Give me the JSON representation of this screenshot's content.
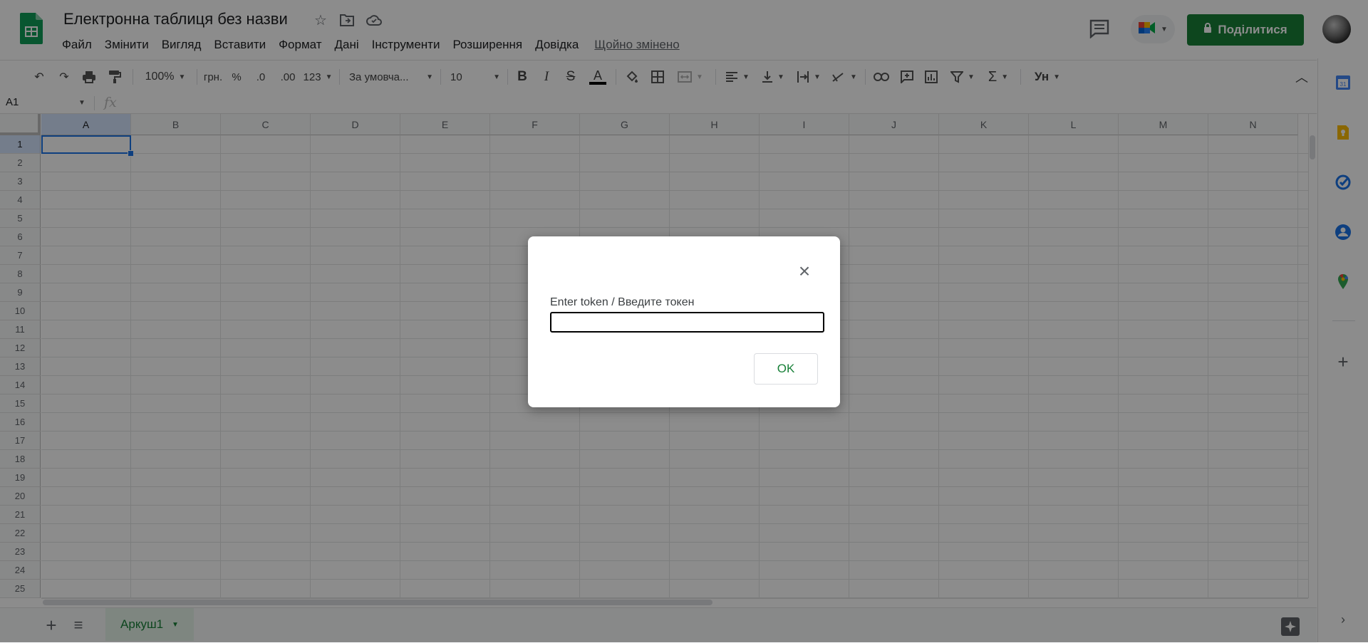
{
  "header": {
    "title": "Електронна таблиця без назви",
    "star_icon": "star-icon",
    "move_icon": "folder-move-icon",
    "cloud_icon": "cloud-status-icon",
    "last_edit": "Щойно змінено",
    "share_label": "Поділитися"
  },
  "menu": [
    "Файл",
    "Змінити",
    "Вигляд",
    "Вставити",
    "Формат",
    "Дані",
    "Інструменти",
    "Розширення",
    "Довідка"
  ],
  "toolbar": {
    "zoom": "100%",
    "currency": "грн.",
    "percent": "%",
    "decimal_decrease": ".0",
    "decimal_increase": ".00",
    "more_formats": "123",
    "font": "За умовча...",
    "font_size": "10",
    "bold": "B",
    "italic": "I",
    "strike": "S",
    "text_color_letter": "A",
    "input_tools": "Ун"
  },
  "formula_bar": {
    "cell_ref": "A1",
    "fx": "fx"
  },
  "grid": {
    "columns": [
      "A",
      "B",
      "C",
      "D",
      "E",
      "F",
      "G",
      "H",
      "I",
      "J",
      "K",
      "L",
      "M",
      "N"
    ],
    "rows": [
      "1",
      "2",
      "3",
      "4",
      "5",
      "6",
      "7",
      "8",
      "9",
      "10",
      "11",
      "12",
      "13",
      "14",
      "15",
      "16",
      "17",
      "18",
      "19",
      "20",
      "21",
      "22",
      "23",
      "24",
      "25"
    ],
    "active_cell": "A1"
  },
  "sheets": {
    "tabs": [
      "Аркуш1"
    ]
  },
  "dialog": {
    "label": "Enter token / Введите токен",
    "input_value": "",
    "ok_label": "OK"
  },
  "colors": {
    "accent_green": "#188038",
    "selection_blue": "#1a73e8",
    "overlay": "rgba(0,0,0,0.45)"
  }
}
